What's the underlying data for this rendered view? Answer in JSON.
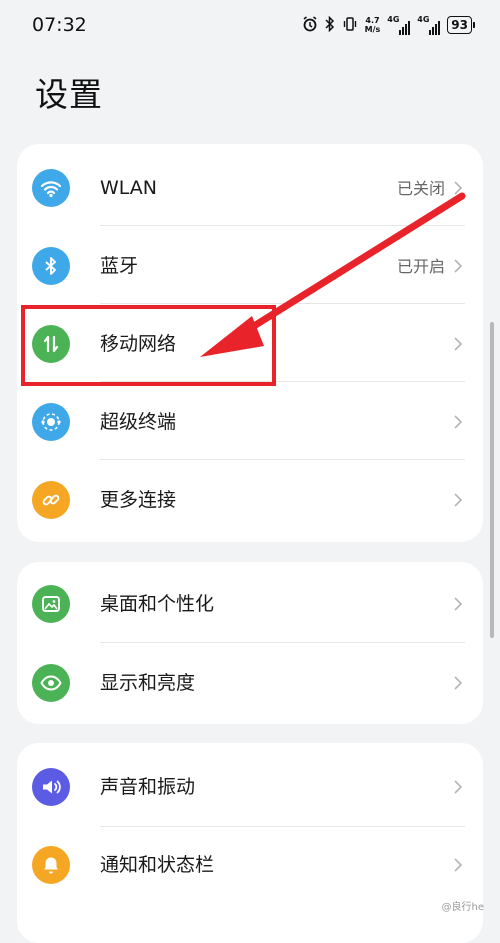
{
  "status_bar": {
    "time": "07:32",
    "speed_value": "4.7",
    "speed_unit": "M/s",
    "net1": "4G",
    "net2": "4G",
    "battery": "93"
  },
  "page": {
    "title": "设置"
  },
  "groups": [
    {
      "items": [
        {
          "label": "WLAN",
          "value": "已关闭",
          "icon": "wifi-icon",
          "color": "#3fa8e9"
        },
        {
          "label": "蓝牙",
          "value": "已开启",
          "icon": "bluetooth-icon",
          "color": "#3fa8e9"
        },
        {
          "label": "移动网络",
          "value": "",
          "icon": "mobile-data-icon",
          "color": "#4bb256"
        },
        {
          "label": "超级终端",
          "value": "",
          "icon": "super-device-icon",
          "color": "#3fa8e9"
        },
        {
          "label": "更多连接",
          "value": "",
          "icon": "link-icon",
          "color": "#f5a623"
        }
      ]
    },
    {
      "items": [
        {
          "label": "桌面和个性化",
          "value": "",
          "icon": "wallpaper-icon",
          "color": "#4bb256"
        },
        {
          "label": "显示和亮度",
          "value": "",
          "icon": "eye-icon",
          "color": "#4bb256"
        }
      ]
    },
    {
      "items": [
        {
          "label": "声音和振动",
          "value": "",
          "icon": "speaker-icon",
          "color": "#5b5ce3"
        },
        {
          "label": "通知和状态栏",
          "value": "",
          "icon": "bell-icon",
          "color": "#f5a623"
        }
      ]
    }
  ],
  "annotation": {
    "color": "#e8232a"
  },
  "watermark": "@良行he"
}
